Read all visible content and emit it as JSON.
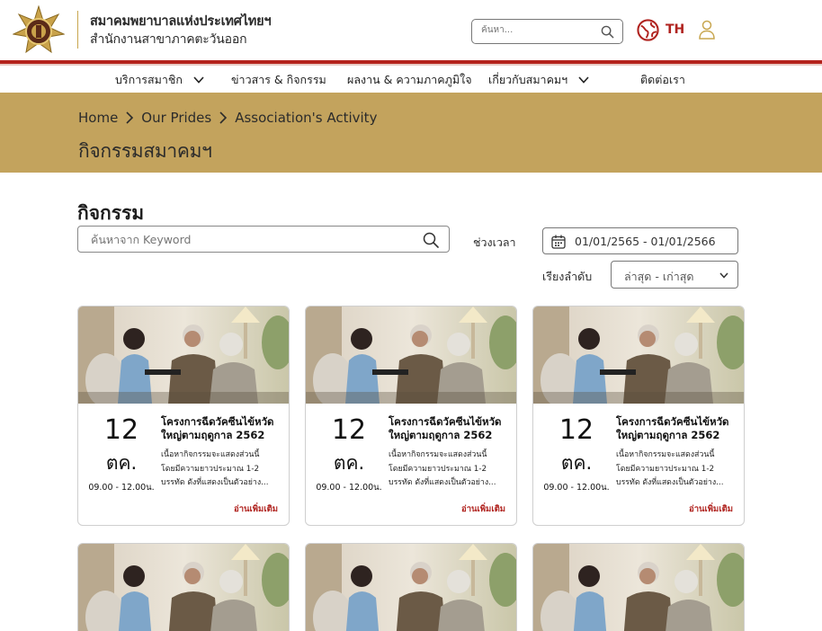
{
  "header": {
    "org_name": "สมาคมพยาบาลแห่งประเทศไทยฯ",
    "org_sub": "สำนักงานสาขาภาคตะวันออก",
    "search_placeholder": "ค้นหา...",
    "lang": "TH",
    "icons": {
      "logo": "association-emblem",
      "search": "search-icon",
      "lang": "globe-icon",
      "user": "user-icon"
    }
  },
  "nav": {
    "items": [
      {
        "label": "บริการสมาชิก",
        "has_dropdown": true
      },
      {
        "label": "ข่าวสาร & กิจกรรม",
        "has_dropdown": false
      },
      {
        "label": "ผลงาน & ความภาคภูมิใจ",
        "has_dropdown": false
      },
      {
        "label": "เกี่ยวกับสมาคมฯ",
        "has_dropdown": true
      },
      {
        "label": "ติดต่อเรา",
        "has_dropdown": false
      }
    ]
  },
  "banner": {
    "breadcrumb": [
      "Home",
      "Our Prides",
      "Association's Activity"
    ],
    "title": "กิจกรรมสมาคมฯ"
  },
  "filters": {
    "section_title": "กิจกรรม",
    "keyword_placeholder": "ค้นหาจาก Keyword",
    "period_label": "ช่วงเวลา",
    "date_range": "01/01/2565 - 01/01/2566",
    "sort_label": "เรียงลำดับ",
    "sort_value": "ล่าสุด - เก่าสุด"
  },
  "cards": [
    {
      "day": "12",
      "month": "ตค.",
      "time": "09.00 - 12.00น.",
      "title": "โครงการฉีดวัคซีนไข้หวัดใหญ่ตามฤดูกาล 2562",
      "desc_lines": [
        "เนื้อหากิจกรรมจะแสดงส่วนนี้",
        "โดยมีความยาวประมาณ 1-2",
        "บรรทัด ดังที่แสดงเป็นตัวอย่าง..."
      ],
      "read_more": "อ่านเพิ่มเติม"
    },
    {
      "day": "12",
      "month": "ตค.",
      "time": "09.00 - 12.00น.",
      "title": "โครงการฉีดวัคซีนไข้หวัดใหญ่ตามฤดูกาล 2562",
      "desc_lines": [
        "เนื้อหากิจกรรมจะแสดงส่วนนี้",
        "โดยมีความยาวประมาณ 1-2",
        "บรรทัด ดังที่แสดงเป็นตัวอย่าง..."
      ],
      "read_more": "อ่านเพิ่มเติม"
    },
    {
      "day": "12",
      "month": "ตค.",
      "time": "09.00 - 12.00น.",
      "title": "โครงการฉีดวัคซีนไข้หวัดใหญ่ตามฤดูกาล 2562",
      "desc_lines": [
        "เนื้อหากิจกรรมจะแสดงส่วนนี้",
        "โดยมีความยาวประมาณ 1-2",
        "บรรทัด ดังที่แสดงเป็นตัวอย่าง..."
      ],
      "read_more": "อ่านเพิ่มเติม"
    }
  ],
  "colors": {
    "brand_red": "#b4231c",
    "banner_gold": "#c3a35d",
    "accent_gold": "#c8a64f"
  }
}
